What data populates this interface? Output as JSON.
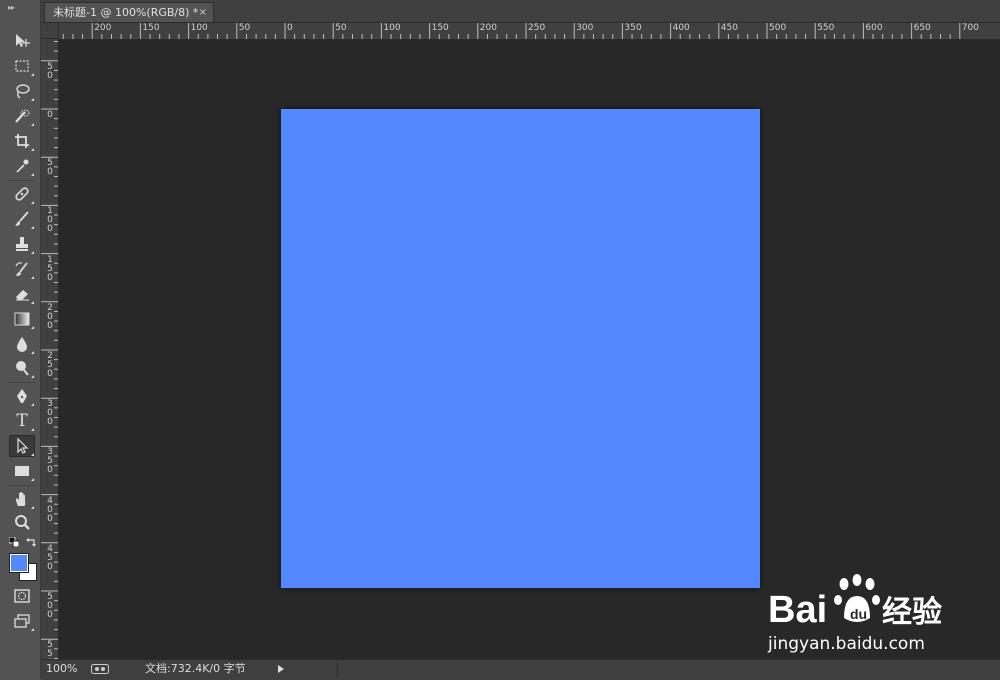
{
  "document_tab": {
    "title": "未标题-1 @ 100%(RGB/8) *",
    "close_glyph": "×"
  },
  "toolbar": {
    "grip": "▸▸",
    "tools": [
      {
        "name": "move-tool",
        "icon": "move-icon"
      },
      {
        "name": "marquee-tool",
        "icon": "rect-marquee-icon"
      },
      {
        "name": "lasso-tool",
        "icon": "lasso-icon"
      },
      {
        "name": "quick-selection-tool",
        "icon": "quick-selection-icon"
      },
      {
        "name": "crop-tool",
        "icon": "crop-icon"
      },
      {
        "name": "eyedropper-tool",
        "icon": "eyedropper-icon"
      },
      {
        "name": "healing-brush-tool",
        "icon": "bandage-icon"
      },
      {
        "name": "brush-tool",
        "icon": "brush-icon"
      },
      {
        "name": "clone-stamp-tool",
        "icon": "stamp-icon"
      },
      {
        "name": "history-brush-tool",
        "icon": "history-brush-icon"
      },
      {
        "name": "eraser-tool",
        "icon": "eraser-icon"
      },
      {
        "name": "gradient-tool",
        "icon": "gradient-icon"
      },
      {
        "name": "blur-tool",
        "icon": "droplet-icon"
      },
      {
        "name": "dodge-tool",
        "icon": "dodge-icon"
      },
      {
        "name": "pen-tool",
        "icon": "pen-icon"
      },
      {
        "name": "type-tool",
        "icon": "type-icon"
      },
      {
        "name": "path-selection-tool",
        "icon": "direct-select-icon"
      },
      {
        "name": "shape-tool",
        "icon": "rectangle-icon"
      },
      {
        "name": "hand-tool",
        "icon": "hand-icon"
      },
      {
        "name": "zoom-tool",
        "icon": "magnifier-icon"
      }
    ],
    "type_glyph": "T",
    "foreground_color": "#5588ff",
    "background_color": "#ffffff"
  },
  "ruler_top": [
    "200",
    "150",
    "100",
    "50",
    "0",
    "50",
    "100",
    "150",
    "200",
    "250",
    "300",
    "350",
    "400",
    "450",
    "500",
    "550",
    "600",
    "650",
    "700"
  ],
  "ruler_left": [
    [
      "5",
      "0"
    ],
    [
      "0"
    ],
    [
      "5",
      "0"
    ],
    [
      "1",
      "0",
      "0"
    ],
    [
      "1",
      "5",
      "0"
    ],
    [
      "2",
      "0",
      "0"
    ],
    [
      "2",
      "5",
      "0"
    ],
    [
      "3",
      "0",
      "0"
    ],
    [
      "3",
      "5",
      "0"
    ],
    [
      "4",
      "0",
      "0"
    ],
    [
      "4",
      "5",
      "0"
    ],
    [
      "5",
      "0",
      "0"
    ],
    [
      "5",
      "5",
      "0"
    ]
  ],
  "canvas": {
    "fill_color": "#5588ff"
  },
  "status": {
    "zoom": "100%",
    "doc_info": "文档:732.4K/0 字节"
  },
  "watermark": {
    "brand_latin": "Bai",
    "brand_cjk": "经验",
    "url": "jingyan.baidu.com"
  }
}
